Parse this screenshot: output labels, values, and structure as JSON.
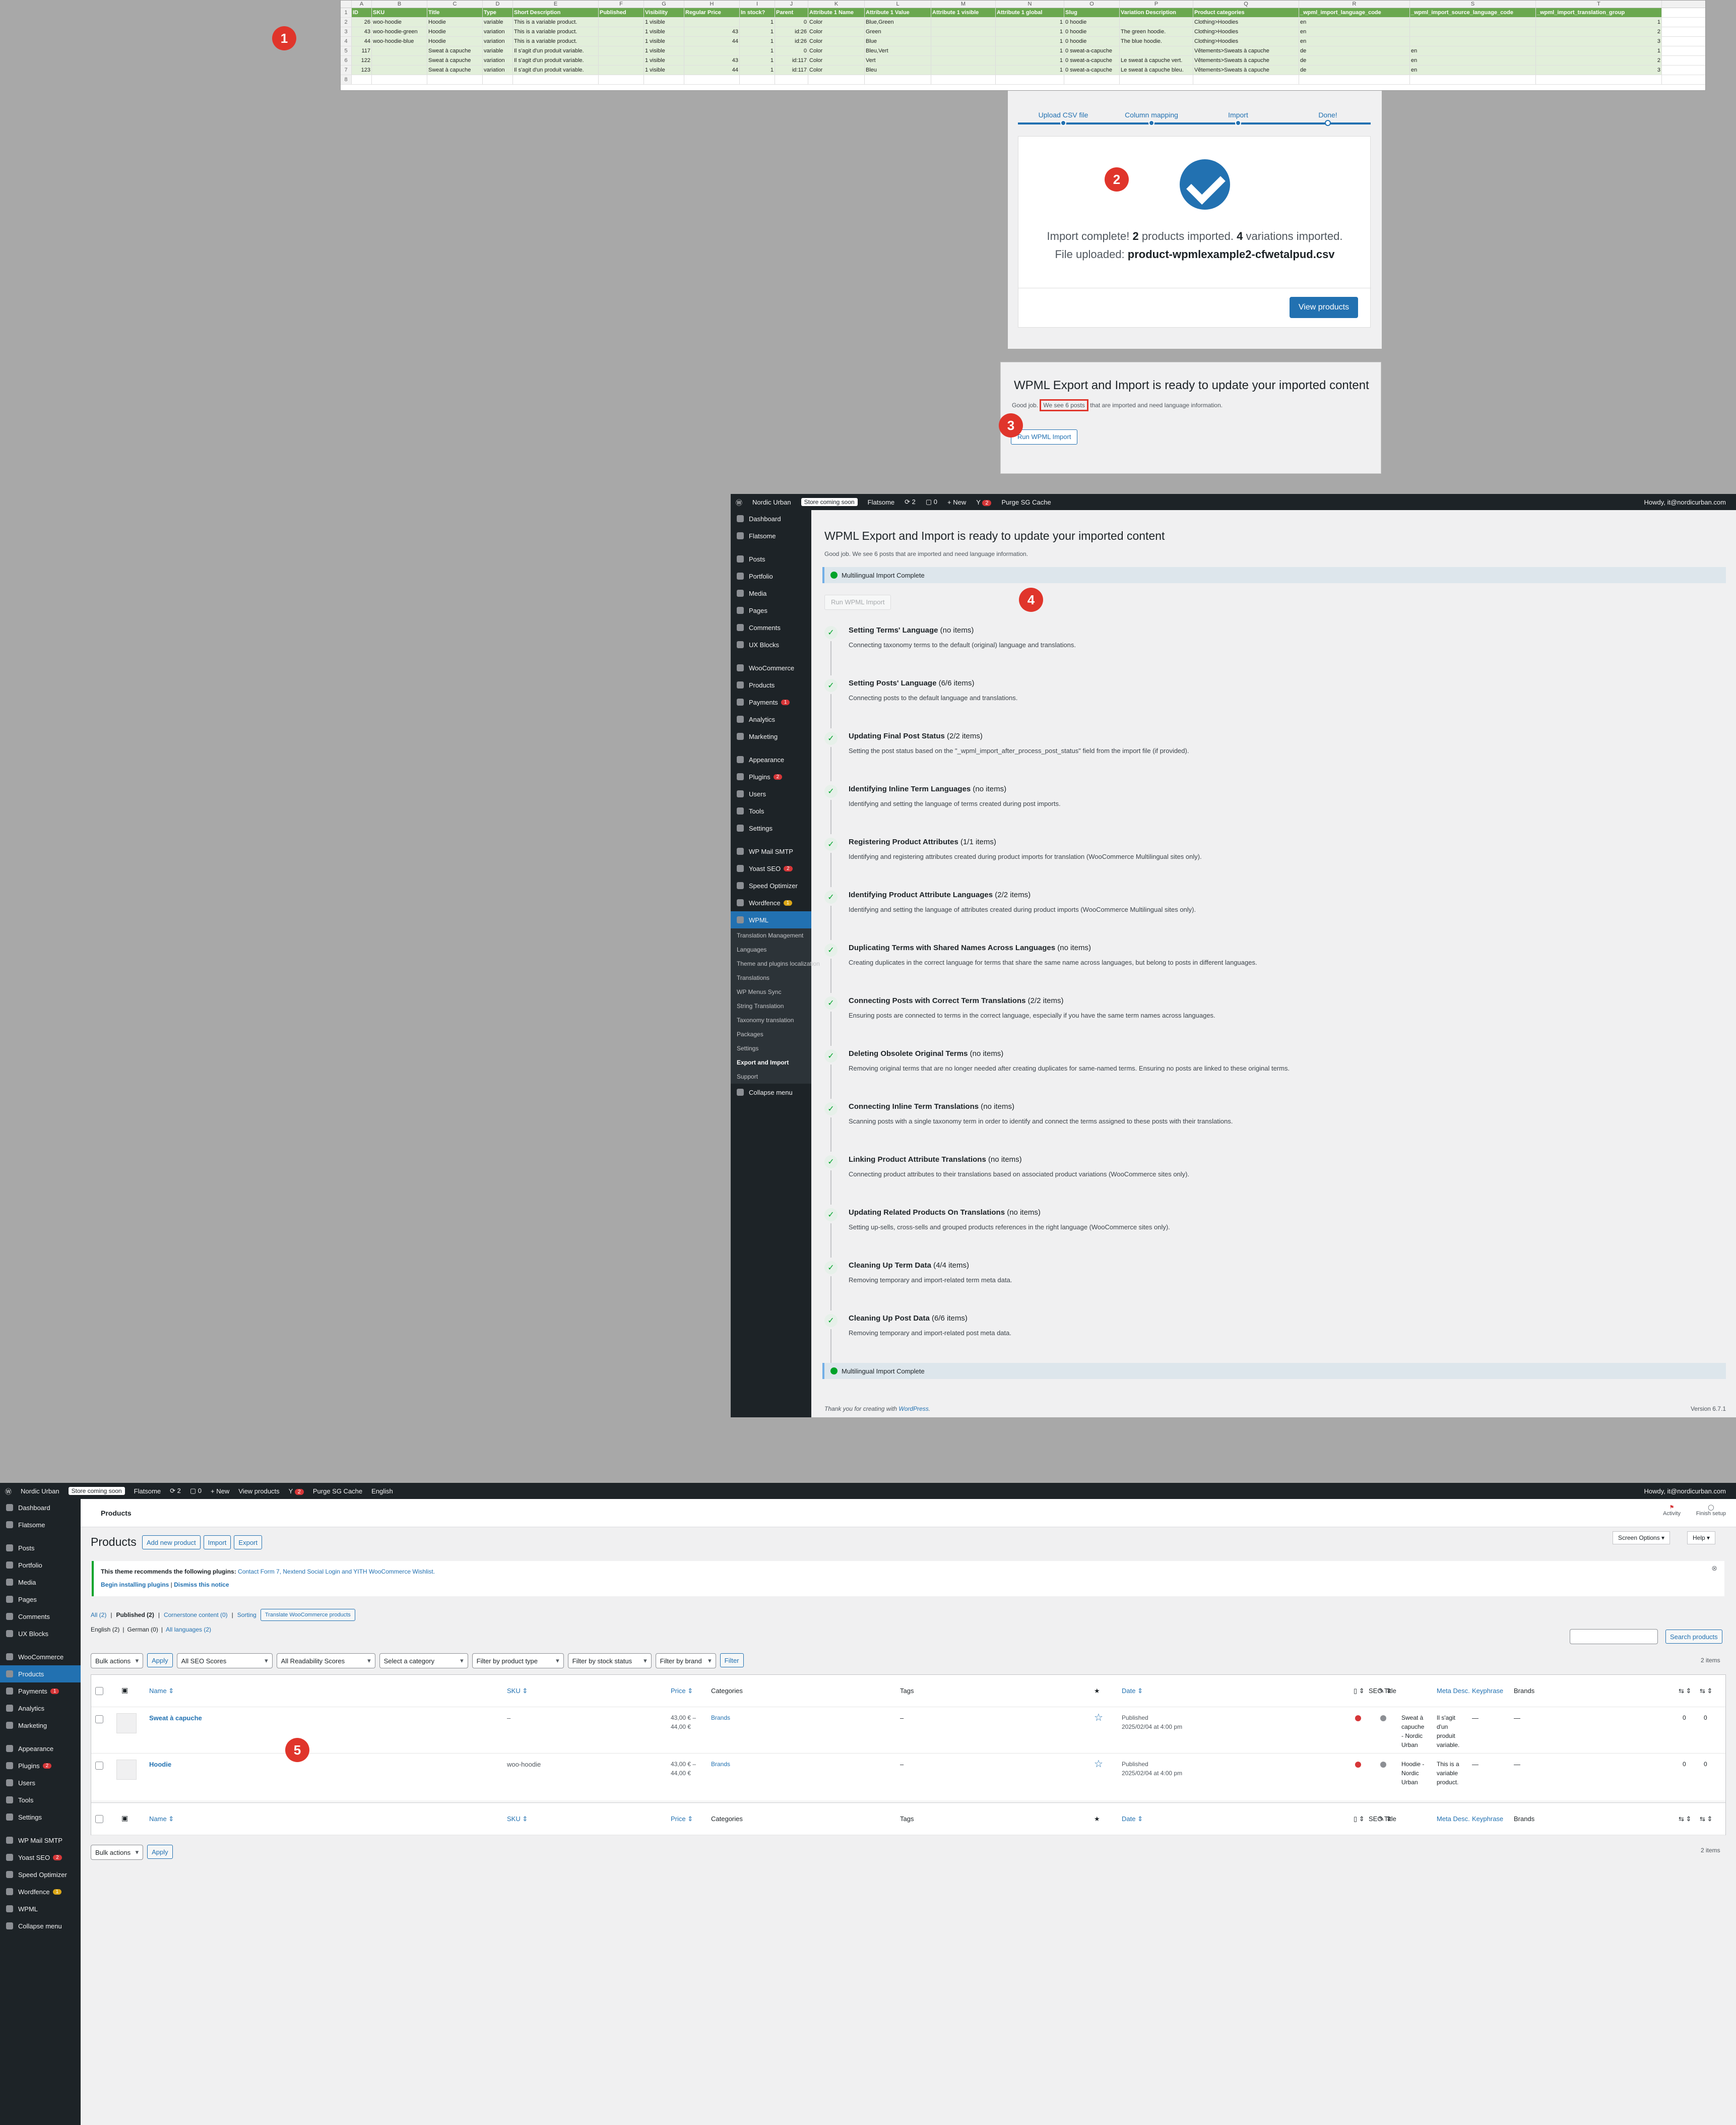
{
  "badges": [
    "1",
    "2",
    "3",
    "4",
    "5"
  ],
  "sheet": {
    "col_letters": [
      "",
      "A",
      "B",
      "C",
      "D",
      "E",
      "F",
      "G",
      "H",
      "I",
      "J",
      "K",
      "L",
      "M",
      "N",
      "O",
      "P",
      "Q",
      "R",
      "S",
      "T"
    ],
    "header": [
      "1",
      "ID",
      "SKU",
      "Title",
      "Type",
      "Short Description",
      "Published",
      "Visibility",
      "Regular Price",
      "In stock?",
      "Parent",
      "Attribute 1 Name",
      "Attribute 1 Value",
      "Attribute 1 visible",
      "Attribute 1 global",
      "Slug",
      "Variation Description",
      "Product categories",
      "_wpml_import_language_code",
      "_wpml_import_source_language_code",
      "_wpml_import_translation_group"
    ],
    "rows": [
      [
        "2",
        "26",
        "woo-hoodie",
        "Hoodie",
        "variable",
        "This is a variable product.",
        "",
        "1 visible",
        "",
        "1",
        "0",
        "Color",
        "Blue,Green",
        "",
        "1",
        "0 hoodie",
        "",
        "Clothing>Hoodies",
        "en",
        "",
        "1"
      ],
      [
        "3",
        "43",
        "woo-hoodie-green",
        "Hoodie",
        "variation",
        "This is a variable product.",
        "",
        "1 visible",
        "43",
        "1",
        "id:26",
        "Color",
        "Green",
        "",
        "1",
        "0 hoodie",
        "The green hoodie.",
        "Clothing>Hoodies",
        "en",
        "",
        "2"
      ],
      [
        "4",
        "44",
        "woo-hoodie-blue",
        "Hoodie",
        "variation",
        "This is a variable product.",
        "",
        "1 visible",
        "44",
        "1",
        "id:26",
        "Color",
        "Blue",
        "",
        "1",
        "0 hoodie",
        "The blue hoodie.",
        "Clothing>Hoodies",
        "en",
        "",
        "3"
      ],
      [
        "5",
        "117",
        "",
        "Sweat à capuche",
        "variable",
        "Il s'agit d'un produit variable.",
        "",
        "1 visible",
        "",
        "1",
        "0",
        "Color",
        "Bleu,Vert",
        "",
        "1",
        "0 sweat-a-capuche",
        "",
        "Vêtements>Sweats à capuche",
        "de",
        "en",
        "1"
      ],
      [
        "6",
        "122",
        "",
        "Sweat à capuche",
        "variation",
        "Il s'agit d'un produit variable.",
        "",
        "1 visible",
        "43",
        "1",
        "id:117",
        "Color",
        "Vert",
        "",
        "1",
        "0 sweat-a-capuche",
        "Le sweat à capuche vert.",
        "Vêtements>Sweats à capuche",
        "de",
        "en",
        "2"
      ],
      [
        "7",
        "123",
        "",
        "Sweat à capuche",
        "variation",
        "Il s'agit d'un produit variable.",
        "",
        "1 visible",
        "44",
        "1",
        "id:117",
        "Color",
        "Bleu",
        "",
        "1",
        "0 sweat-a-capuche",
        "Le sweat à capuche bleu.",
        "Vêtements>Sweats à capuche",
        "de",
        "en",
        "3"
      ],
      [
        "8",
        "",
        "",
        "",
        "",
        "",
        "",
        "",
        "",
        "",
        "",
        "",
        "",
        "",
        "",
        "",
        "",
        "",
        "",
        "",
        ""
      ]
    ]
  },
  "import": {
    "steps": [
      "Upload CSV file",
      "Column mapping",
      "Import",
      "Done!"
    ],
    "msg_pre": "Import complete! ",
    "products": "2",
    "msg_mid": " products imported. ",
    "variations": "4",
    "msg_post": " variations imported. File uploaded: ",
    "file": "product-wpmlexample2-cfwetalpud.csv",
    "view_button": "View products"
  },
  "wpml_small": {
    "title": "WPML Export and Import is ready to update your imported content",
    "text_pre": "Good job.",
    "text_hl": "We see 6 posts",
    "text_post": "that are imported and need language information.",
    "button": "Run WPML Import"
  },
  "adminbar": {
    "site": "Nordic Urban",
    "coming_soon": "Store coming soon",
    "theme": "Flatsome",
    "updates": "2",
    "comments": "0",
    "new": "+ New",
    "yoast_count": "2",
    "purge": "Purge SG Cache",
    "howdy": "Howdy, it@nordicurban.com",
    "view_products": "View products",
    "language": "English"
  },
  "sidebar": {
    "items": [
      "Dashboard",
      "Flatsome",
      "Posts",
      "Portfolio",
      "Media",
      "Pages",
      "Comments",
      "UX Blocks",
      "WooCommerce",
      "Products",
      "Payments",
      "Analytics",
      "Marketing",
      "Appearance",
      "Plugins",
      "Users",
      "Tools",
      "Settings",
      "WP Mail SMTP",
      "Yoast SEO",
      "Speed Optimizer",
      "Wordfence",
      "WPML"
    ],
    "wpml_sub": [
      "Translation Management",
      "Languages",
      "Theme and plugins localization",
      "Translations",
      "WP Menus Sync",
      "String Translation",
      "Taxonomy translation",
      "Packages",
      "Settings",
      "Export and Import",
      "Support"
    ],
    "collapse": "Collapse menu",
    "payments_count": "1",
    "plugins_count": "2",
    "yoast_count": "2",
    "wordfence_count": "1"
  },
  "wpml_page": {
    "title": "WPML Export and Import is ready to update your imported content",
    "subtitle": "Good job. We see 6 posts that are imported and need language information.",
    "complete": "Multilingual Import Complete",
    "run_button": "Run WPML Import",
    "steps": [
      {
        "title": "Setting Terms' Language",
        "count": "(no items)",
        "desc": "Connecting taxonomy terms to the default (original) language and translations."
      },
      {
        "title": "Setting Posts' Language",
        "count": "(6/6 items)",
        "desc": "Connecting posts to the default language and translations."
      },
      {
        "title": "Updating Final Post Status",
        "count": "(2/2 items)",
        "desc": "Setting the post status based on the \"_wpml_import_after_process_post_status\" field from the import file (if provided)."
      },
      {
        "title": "Identifying Inline Term Languages",
        "count": "(no items)",
        "desc": "Identifying and setting the language of terms created during post imports."
      },
      {
        "title": "Registering Product Attributes",
        "count": "(1/1 items)",
        "desc": "Identifying and registering attributes created during product imports for translation (WooCommerce Multilingual sites only)."
      },
      {
        "title": "Identifying Product Attribute Languages",
        "count": "(2/2 items)",
        "desc": "Identifying and setting the language of attributes created during product imports (WooCommerce Multilingual sites only)."
      },
      {
        "title": "Duplicating Terms with Shared Names Across Languages",
        "count": "(no items)",
        "desc": "Creating duplicates in the correct language for terms that share the same name across languages, but belong to posts in different languages."
      },
      {
        "title": "Connecting Posts with Correct Term Translations",
        "count": "(2/2 items)",
        "desc": "Ensuring posts are connected to terms in the correct language, especially if you have the same term names across languages."
      },
      {
        "title": "Deleting Obsolete Original Terms",
        "count": "(no items)",
        "desc": "Removing original terms that are no longer needed after creating duplicates for same-named terms. Ensuring no posts are linked to these original terms."
      },
      {
        "title": "Connecting Inline Term Translations",
        "count": "(no items)",
        "desc": "Scanning posts with a single taxonomy term in order to identify and connect the terms assigned to these posts with their translations."
      },
      {
        "title": "Linking Product Attribute Translations",
        "count": "(no items)",
        "desc": "Connecting product attributes to their translations based on associated product variations (WooCommerce sites only)."
      },
      {
        "title": "Updating Related Products On Translations",
        "count": "(no items)",
        "desc": "Setting up-sells, cross-sells and grouped products references in the right language (WooCommerce sites only)."
      },
      {
        "title": "Cleaning Up Term Data",
        "count": "(4/4 items)",
        "desc": "Removing temporary and import-related term meta data."
      },
      {
        "title": "Cleaning Up Post Data",
        "count": "(6/6 items)",
        "desc": "Removing temporary and import-related post meta data."
      }
    ],
    "footer_pre": "Thank you for creating with ",
    "footer_link": "WordPress",
    "version": "Version 6.7.1"
  },
  "products_page": {
    "breadcrumb": "Products",
    "activity": "Activity",
    "finish_setup": "Finish setup",
    "heading": "Products",
    "add_new": "Add new product",
    "import": "Import",
    "export": "Export",
    "screen_options": "Screen Options ▾",
    "help": "Help ▾",
    "notice_pre": "This theme recommends the following plugins: ",
    "notice_plugins": "Contact Form 7, Nextend Social Login and YITH WooCommerce Wishlist.",
    "notice_begin": "Begin installing plugins",
    "notice_dismiss": "Dismiss this notice",
    "filters_links": [
      "All (2)",
      "Published (2)",
      "Cornerstone content (0)",
      "Sorting"
    ],
    "translate_btn": "Translate WooCommerce products",
    "lang_links": [
      "English (2)",
      "German (0)",
      "All languages (2)"
    ],
    "search_btn": "Search products",
    "items_count": "2 items",
    "bulk": "Bulk actions",
    "apply": "Apply",
    "seo_scores": "All SEO Scores",
    "readability": "All Readability Scores",
    "category": "Select a category",
    "ptype": "Filter by product type",
    "stock": "Filter by stock status",
    "brand": "Filter by brand",
    "filter": "Filter",
    "columns": [
      "Name ⇕",
      "SKU ⇕",
      "Price ⇕",
      "Categories",
      "Tags",
      "★",
      "Date ⇕",
      "SEO Title",
      "Meta Desc.",
      "Keyphrase",
      "Brands"
    ],
    "rows": [
      {
        "name": "Sweat à capuche",
        "sku": "–",
        "price1": "43,00 € –",
        "price2": "44,00 €",
        "cat": "Brands",
        "tags": "–",
        "date1": "Published",
        "date2": "2025/02/04 at 4:00 pm",
        "seo1": "Sweat à",
        "seo2": "capuche",
        "seo3": "- Nordic",
        "seo4": "Urban",
        "meta1": "Il s'agit",
        "meta2": "d'un",
        "meta3": "produit",
        "meta4": "variable.",
        "kp": "—",
        "br": "—",
        "n1": "0",
        "n2": "0"
      },
      {
        "name": "Hoodie",
        "sku": "woo-hoodie",
        "price1": "43,00 € –",
        "price2": "44,00 €",
        "cat": "Brands",
        "tags": "–",
        "date1": "Published",
        "date2": "2025/02/04 at 4:00 pm",
        "seo1": "Hoodie -",
        "seo2": "Nordic",
        "seo3": "Urban",
        "seo4": "",
        "meta1": "This is a",
        "meta2": "variable",
        "meta3": "product.",
        "meta4": "",
        "kp": "—",
        "br": "—",
        "n1": "0",
        "n2": "0"
      }
    ]
  }
}
